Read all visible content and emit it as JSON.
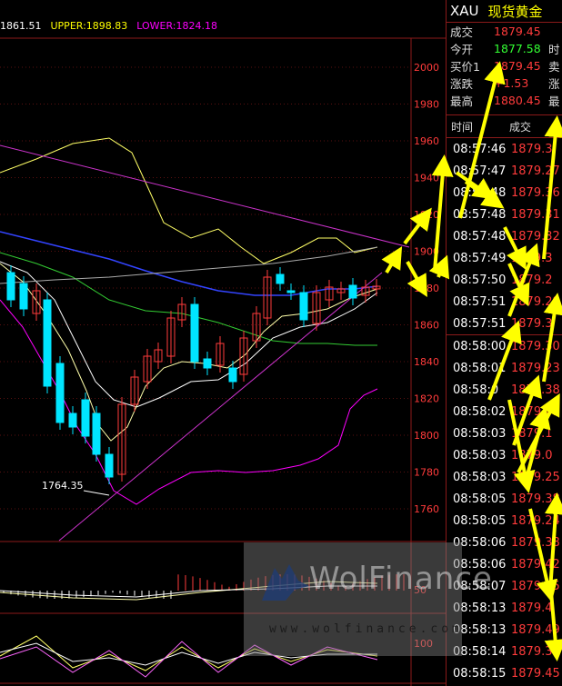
{
  "indicator_bar": {
    "mid": "1861.51",
    "upper": "UPPER:1898.83",
    "lower": "LOWER:1824.18"
  },
  "price_axis": [
    "2000",
    "1980",
    "1960",
    "1940",
    "1920",
    "1900",
    "1880",
    "1860",
    "1840",
    "1820",
    "1800",
    "1780",
    "1760"
  ],
  "low_label": "1764.35",
  "lower_axis": {
    "mid_label": "50",
    "rsi_label": "100"
  },
  "quote": {
    "code": "XAU",
    "name": "现货黄金",
    "rows": [
      {
        "label": "成交",
        "value": "1879.45",
        "color": "#ff3b3b",
        "extra": ""
      },
      {
        "label": "今开",
        "value": "1877.58",
        "color": "#33ff33",
        "extra": "时"
      },
      {
        "label": "买价1",
        "value": "1879.45",
        "color": "#ff3b3b",
        "extra": "卖"
      },
      {
        "label": "涨跌",
        "value": "+1.53",
        "color": "#ff3b3b",
        "extra": "涨"
      },
      {
        "label": "最高",
        "value": "1880.45",
        "color": "#ff3b3b",
        "extra": "最"
      }
    ],
    "ticks_header": {
      "time": "时间",
      "price": "成交"
    },
    "ticks": [
      {
        "time": "08:57:46",
        "price": "1879.3"
      },
      {
        "time": "08:57:47",
        "price": "1879.27"
      },
      {
        "time": "08:57:48",
        "price": "1879.36"
      },
      {
        "time": "08:57:48",
        "price": "1879.31"
      },
      {
        "time": "08:57:48",
        "price": "1879.32"
      },
      {
        "time": "08:57:49",
        "price": "1879.3"
      },
      {
        "time": "08:57:50",
        "price": "1879.2"
      },
      {
        "time": "08:57:51",
        "price": "1879.29"
      },
      {
        "time": "08:57:51",
        "price": "1879.3"
      },
      {
        "time": "08:58:00",
        "price": "1879.30"
      },
      {
        "time": "08:58:01",
        "price": "1879.23"
      },
      {
        "time": "08:58:0",
        "price": "1879.38"
      },
      {
        "time": "08:58:02",
        "price": "1879.41"
      },
      {
        "time": "08:58:03",
        "price": "1879.1"
      },
      {
        "time": "08:58:03",
        "price": "1879.0"
      },
      {
        "time": "08:58:03",
        "price": "1879.25"
      },
      {
        "time": "08:58:05",
        "price": "1879.38"
      },
      {
        "time": "08:58:05",
        "price": "1879.24"
      },
      {
        "time": "08:58:06",
        "price": "1879.38"
      },
      {
        "time": "08:58:06",
        "price": "1879.42"
      },
      {
        "time": "08:58:07",
        "price": "1879.45"
      },
      {
        "time": "08:58:13",
        "price": "1879.4"
      },
      {
        "time": "08:58:13",
        "price": "1879.49"
      },
      {
        "time": "08:58:14",
        "price": "1879.31"
      },
      {
        "time": "08:58:15",
        "price": "1879.45"
      }
    ]
  },
  "watermark": {
    "logo": "WolFinance",
    "url": "www.wolfinance.com"
  },
  "colors": {
    "up": "#ff3b3b",
    "down": "#00e5ff",
    "grid": "#8b1a1a",
    "arrow": "#ffff00"
  }
}
